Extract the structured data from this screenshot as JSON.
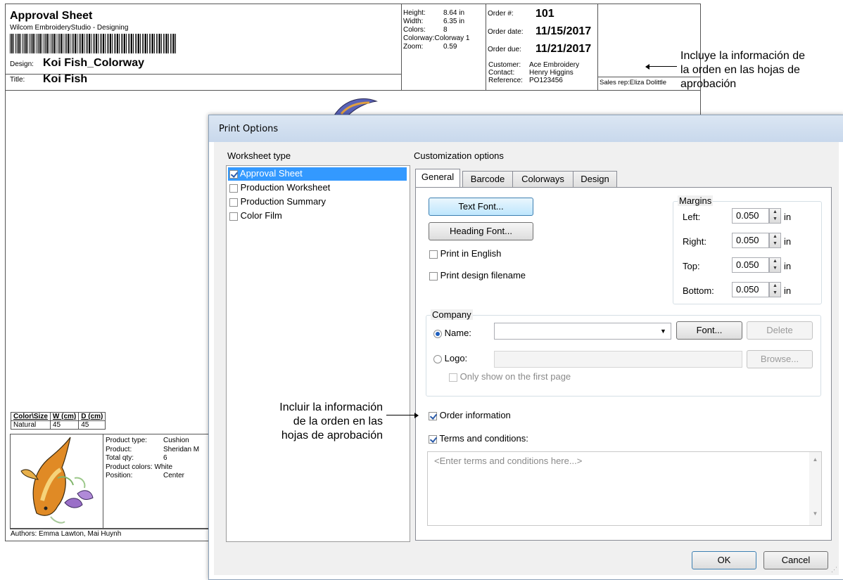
{
  "sheet": {
    "title": "Approval Sheet",
    "subtitle": "Wilcom EmbroideryStudio - Designing",
    "design_label": "Design:",
    "design_value": "Koi Fish_Colorway",
    "title_label": "Title:",
    "title_value": "Koi Fish",
    "stats": {
      "height_label": "Height:",
      "height_value": "8.64 in",
      "width_label": "Width:",
      "width_value": "6.35 in",
      "colors_label": "Colors:",
      "colors_value": "8",
      "colorway_label": "Colorway:",
      "colorway_value": "Colorway 1",
      "zoom_label": "Zoom:",
      "zoom_value": "0.59"
    },
    "order": {
      "number_label": "Order #:",
      "number_value": "101",
      "date_label": "Order date:",
      "date_value": "11/15/2017",
      "due_label": "Order due:",
      "due_value": "11/21/2017",
      "customer_label": "Customer:",
      "customer_value": "Ace Embroidery",
      "contact_label": "Contact:",
      "contact_value": "Henry Higgins",
      "reference_label": "Reference:",
      "reference_value": "PO123456",
      "salesrep": "Sales rep:Eliza Dolittle"
    },
    "size_table": {
      "headers": [
        "Color\\Size",
        "W (cm)",
        "D (cm)"
      ],
      "row": [
        "Natural",
        "45",
        "45"
      ]
    },
    "product": {
      "type_label": "Product type:",
      "type_value": "Cushion",
      "product_label": "Product:",
      "product_value": "Sheridan M",
      "qty_label": "Total qty:",
      "qty_value": "6",
      "colors_label": "Product colors:",
      "colors_value": "White",
      "position_label": "Position:",
      "position_value": "Center"
    },
    "authors": "Authors: Emma Lawton, Mai Huynh"
  },
  "annotations": {
    "top_right": [
      "Incluye la información de",
      "la orden en las hojas de",
      "aprobación"
    ],
    "left": [
      "Incluir la información",
      "de la orden en las",
      "hojas de aprobación"
    ]
  },
  "dialog": {
    "title": "Print Options",
    "worksheet_type_label": "Worksheet type",
    "worksheets": [
      {
        "label": "Approval Sheet",
        "checked": true
      },
      {
        "label": "Production Worksheet",
        "checked": false
      },
      {
        "label": "Production Summary",
        "checked": false
      },
      {
        "label": "Color Film",
        "checked": false
      }
    ],
    "customization_label": "Customization options",
    "tabs": [
      "General",
      "Barcode",
      "Colorways",
      "Design"
    ],
    "text_font_button": "Text Font...",
    "heading_font_button": "Heading Font...",
    "print_english": "Print in English",
    "print_filename": "Print design filename",
    "margins": {
      "label": "Margins",
      "unit": "in",
      "left_label": "Left:",
      "left_value": "0.050",
      "right_label": "Right:",
      "right_value": "0.050",
      "top_label": "Top:",
      "top_value": "0.050",
      "bottom_label": "Bottom:",
      "bottom_value": "0.050"
    },
    "company": {
      "label": "Company",
      "name_label": "Name:",
      "name_value": "",
      "font_button": "Font...",
      "delete_button": "Delete",
      "logo_label": "Logo:",
      "logo_value": "",
      "browse_button": "Browse...",
      "only_first": "Only show on the first page"
    },
    "order_information": "Order information",
    "terms_label": "Terms and conditions:",
    "terms_placeholder": "<Enter terms and conditions here...>",
    "ok_button": "OK",
    "cancel_button": "Cancel"
  }
}
